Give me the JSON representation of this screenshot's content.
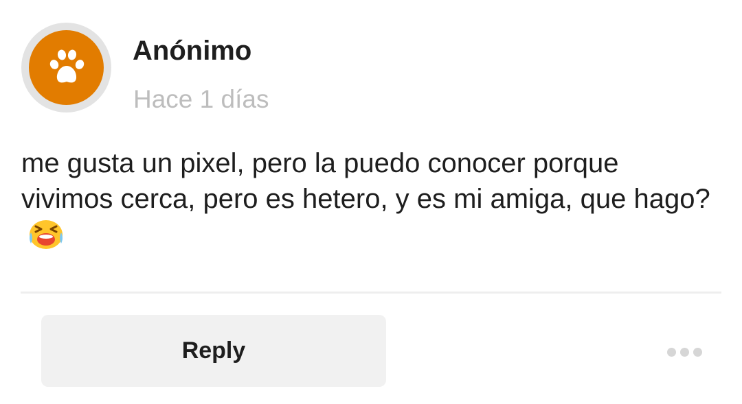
{
  "post": {
    "author": "Anónimo",
    "timestamp": "Hace 1 días",
    "body": "me gusta un pixel, pero la puedo conocer porque vivimos cerca, pero es hetero, y es mi amiga, que hago?",
    "emoji": "crying-face-emoji"
  },
  "avatar": {
    "icon": "paw-icon",
    "color": "#e27c00",
    "ring_color": "#e3e3e3"
  },
  "actions": {
    "reply_label": "Reply",
    "more_icon": "more-options-icon"
  }
}
